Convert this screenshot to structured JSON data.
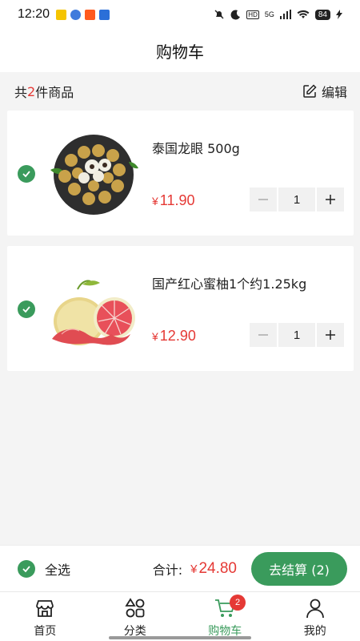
{
  "status_bar": {
    "time": "12:20",
    "network": "5G",
    "battery": "84"
  },
  "header": {
    "title": "购物车"
  },
  "summary": {
    "prefix": "共",
    "count": "2",
    "suffix": "件商品",
    "edit_label": "编辑"
  },
  "items": [
    {
      "name": "泰国龙眼 500g",
      "currency": "¥",
      "price": "11.90",
      "quantity": "1",
      "checked": true
    },
    {
      "name": "国产红心蜜柚1个约1.25kg",
      "currency": "¥",
      "price": "12.90",
      "quantity": "1",
      "checked": true
    }
  ],
  "stepper": {
    "minus": "−",
    "plus": "+"
  },
  "checkout": {
    "select_all_label": "全选",
    "total_label": "合计:",
    "currency": "¥",
    "total": "24.80",
    "button_label": "去结算 (2)"
  },
  "tabbar": {
    "tabs": [
      {
        "label": "首页",
        "icon": "store-icon"
      },
      {
        "label": "分类",
        "icon": "category-icon"
      },
      {
        "label": "购物车",
        "icon": "cart-icon",
        "active": true,
        "badge": "2"
      },
      {
        "label": "我的",
        "icon": "user-icon"
      }
    ]
  },
  "colors": {
    "accent": "#3a9b5c",
    "price": "#e53935"
  }
}
